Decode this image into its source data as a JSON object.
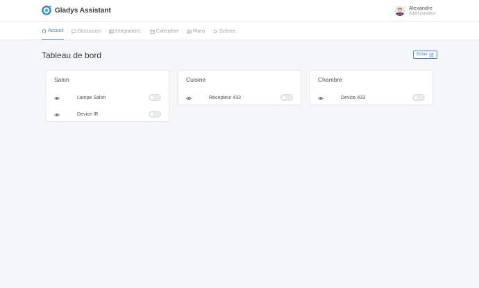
{
  "app": {
    "name": "Gladys Assistant"
  },
  "user": {
    "name": "Alexandre",
    "role": "Administrateur"
  },
  "nav": [
    {
      "label": "Accueil",
      "icon": "home-icon",
      "active": true
    },
    {
      "label": "Discussion",
      "icon": "message-icon",
      "active": false
    },
    {
      "label": "Intégrations",
      "icon": "grid-icon",
      "active": false
    },
    {
      "label": "Calendrier",
      "icon": "calendar-icon",
      "active": false
    },
    {
      "label": "Plans",
      "icon": "map-icon",
      "active": false
    },
    {
      "label": "Scènes",
      "icon": "play-icon",
      "active": false
    }
  ],
  "page": {
    "title": "Tableau de bord",
    "edit_label": "Editer"
  },
  "rooms": [
    {
      "name": "Salon",
      "devices": [
        {
          "label": "Lampe Salon",
          "on": false
        },
        {
          "label": "Device IR",
          "on": false
        }
      ]
    },
    {
      "name": "Cuisine",
      "devices": [
        {
          "label": "Récepteur 433",
          "on": false
        }
      ]
    },
    {
      "name": "Chambre",
      "devices": [
        {
          "label": "Device 433",
          "on": false
        }
      ]
    }
  ],
  "colors": {
    "accent": "#467fcf",
    "background": "#f4f6fa",
    "muted": "#9aa0ac"
  }
}
